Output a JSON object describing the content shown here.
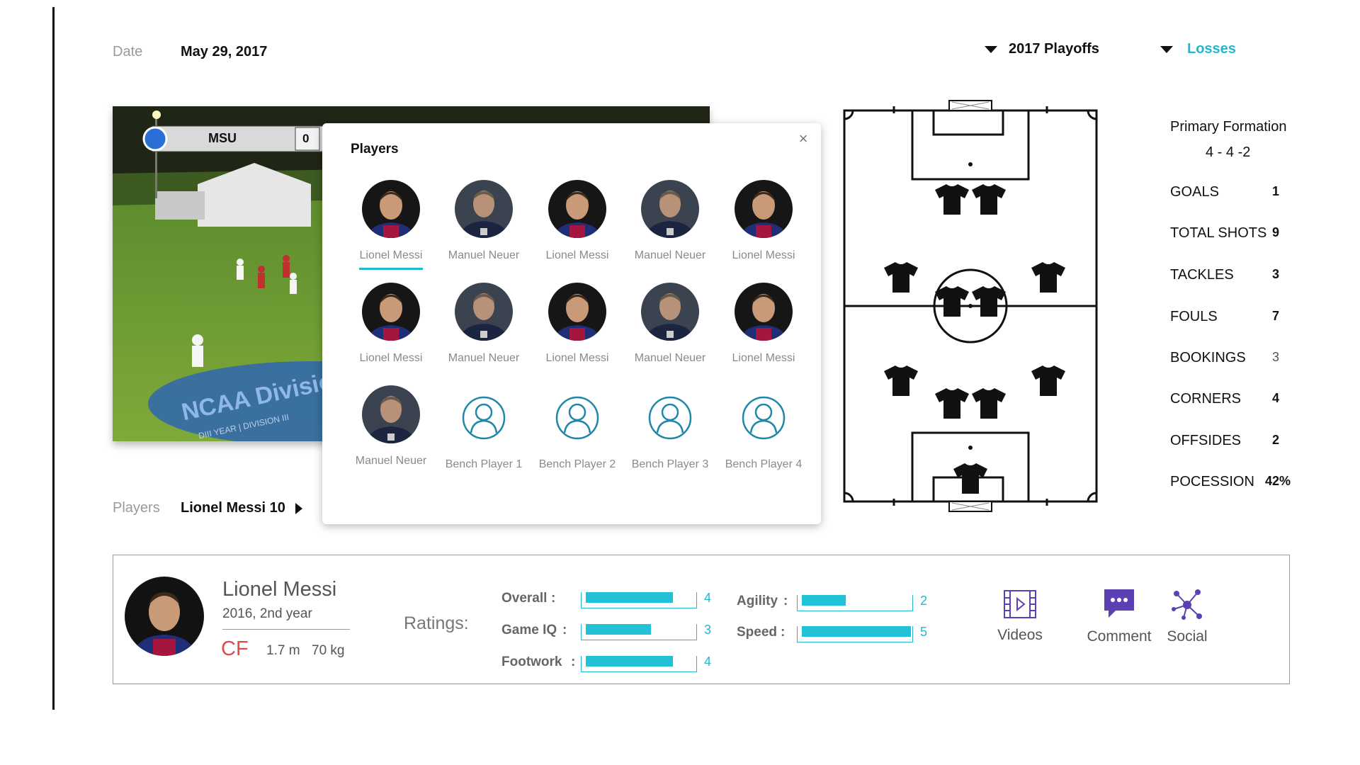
{
  "filters": {
    "date_label": "Date",
    "date_value": "May 29, 2017",
    "season": "2017 Playoffs",
    "result": "Losses"
  },
  "video": {
    "score_team": "MSU",
    "score_value": "0",
    "banner_text": "NCAA Division III",
    "banner_small": "DIII YEAR | DIVISION III"
  },
  "players_popup": {
    "title": "Players",
    "close_label": "×",
    "players": [
      {
        "name": "Lionel Messi",
        "type": "messi",
        "selected": true
      },
      {
        "name": "Manuel Neuer",
        "type": "neuer"
      },
      {
        "name": "Lionel Messi",
        "type": "messi"
      },
      {
        "name": "Manuel Neuer",
        "type": "neuer"
      },
      {
        "name": "Lionel Messi",
        "type": "messi"
      },
      {
        "name": "Lionel Messi",
        "type": "messi"
      },
      {
        "name": "Manuel Neuer",
        "type": "neuer"
      },
      {
        "name": "Lionel Messi",
        "type": "messi"
      },
      {
        "name": "Manuel Neuer",
        "type": "neuer"
      },
      {
        "name": "Lionel Messi",
        "type": "messi"
      },
      {
        "name": "Manuel Neuer",
        "type": "neuer"
      },
      {
        "name": "Bench Player 1",
        "type": "bench"
      },
      {
        "name": "Bench Player 2",
        "type": "bench"
      },
      {
        "name": "Bench Player 3",
        "type": "bench"
      },
      {
        "name": "Bench Player 4",
        "type": "bench"
      }
    ]
  },
  "players_selector": {
    "label": "Players",
    "value": "Lionel Messi 10"
  },
  "formation": {
    "title": "Primary Formation",
    "value": "4 - 4 -2"
  },
  "stats": [
    {
      "label": "GOALS",
      "value": "1"
    },
    {
      "label": "TOTAL SHOTS",
      "value": "9"
    },
    {
      "label": "TACKLES",
      "value": "3"
    },
    {
      "label": "FOULS",
      "value": "7"
    },
    {
      "label": "BOOKINGS",
      "value": "3"
    },
    {
      "label": "CORNERS",
      "value": "4"
    },
    {
      "label": "OFFSIDES",
      "value": "2"
    },
    {
      "label": "POCESSION",
      "value": "42%"
    }
  ],
  "profile": {
    "name": "Lionel Messi",
    "year": "2016, 2nd year",
    "position": "CF",
    "height": "1.7 m",
    "weight": "70 kg",
    "ratings_title": "Ratings:",
    "ratings_max": 5,
    "ratings": [
      {
        "label": "Overall",
        "value": 4
      },
      {
        "label": "Game IQ",
        "value": 3
      },
      {
        "label": "Footwork",
        "value": 4
      },
      {
        "label": "Agility",
        "value": 2
      },
      {
        "label": "Speed",
        "value": 5
      }
    ]
  },
  "actions": [
    {
      "label": "Videos",
      "icon": "film-icon"
    },
    {
      "label": "Comment",
      "icon": "chat-bubble-icon"
    },
    {
      "label": "Social",
      "icon": "network-icon"
    }
  ],
  "colors": {
    "accent": "#22b8cf",
    "position": "#e04a4a",
    "icon_purple": "#5b3fb3"
  }
}
